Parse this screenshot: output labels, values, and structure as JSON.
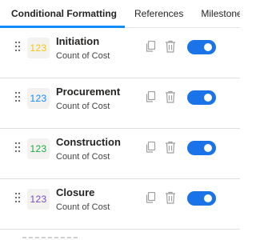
{
  "tabs": [
    {
      "label": "Conditional Formatting",
      "active": true
    },
    {
      "label": "References",
      "active": false
    },
    {
      "label": "Milestones",
      "active": false
    }
  ],
  "rules": [
    {
      "name": "Initiation",
      "measure": "Count of Cost",
      "badge": "123",
      "badge_color": "#f2c80f",
      "enabled": true
    },
    {
      "name": "Procurement",
      "measure": "Count of Cost",
      "badge": "123",
      "badge_color": "#118dff",
      "enabled": true
    },
    {
      "name": "Construction",
      "measure": "Count of Cost",
      "badge": "123",
      "badge_color": "#1aab40",
      "enabled": true
    },
    {
      "name": "Closure",
      "measure": "Count of Cost",
      "badge": "123",
      "badge_color": "#744ec2",
      "enabled": true
    }
  ],
  "icons": {
    "drag": "drag-handle-icon",
    "copy": "copy-icon",
    "delete": "trash-icon"
  },
  "colors": {
    "accent": "#118dff",
    "toggle_on": "#1a73e8",
    "icon": "#a19f9d"
  }
}
